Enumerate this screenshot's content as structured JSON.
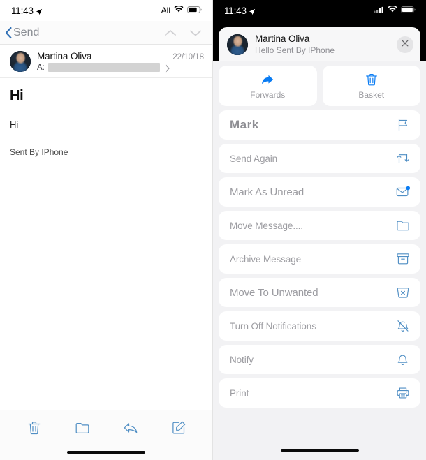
{
  "left": {
    "status": {
      "time": "11:43",
      "carrier_label": "All",
      "location_icon": "location-arrow-icon",
      "wifi_icon": "wifi-icon",
      "battery_icon": "battery-icon"
    },
    "nav": {
      "back_label": "Send",
      "back_icon": "chevron-left-icon",
      "prev_icon": "chevron-up-icon",
      "next_icon": "chevron-down-icon"
    },
    "message": {
      "sender": "Martina Oliva",
      "date": "22/10/18",
      "to_label": "A:",
      "to_value": "",
      "detail_icon": "chevron-right-icon",
      "subject": "Hi",
      "body": "Hi",
      "signature": "Sent By IPhone"
    },
    "toolbar": [
      {
        "name": "delete-button",
        "icon": "trash-icon"
      },
      {
        "name": "move-button",
        "icon": "folder-icon"
      },
      {
        "name": "reply-button",
        "icon": "reply-arrow-icon"
      },
      {
        "name": "compose-button",
        "icon": "compose-icon"
      }
    ]
  },
  "right": {
    "status": {
      "time": "11:43",
      "location_icon": "location-arrow-icon",
      "signal_icon": "cellular-signal-icon",
      "wifi_icon": "wifi-icon",
      "battery_icon": "battery-icon"
    },
    "card": {
      "sender": "Martina Oliva",
      "preview": "Hello Sent By IPhone",
      "close_icon": "close-icon"
    },
    "quick_actions": [
      {
        "label": "Forwards",
        "icon": "forward-arrow-icon"
      },
      {
        "label": "Basket",
        "icon": "trash-icon"
      }
    ],
    "menu_items": [
      {
        "label": "Mark",
        "icon": "flag-icon",
        "size": "big"
      },
      {
        "label": "Send Again",
        "icon": "resend-icon",
        "size": "sm"
      },
      {
        "label": "Mark As Unread",
        "icon": "envelope-badge-icon",
        "size": "lg"
      },
      {
        "label": "Move Message....",
        "icon": "folder-icon",
        "size": "sm"
      },
      {
        "label": "Archive Message",
        "icon": "archive-box-icon",
        "size": "sm"
      },
      {
        "label": "Move To Unwanted",
        "icon": "junk-bin-icon",
        "size": "lg"
      },
      {
        "label": "Turn Off Notifications",
        "icon": "bell-slash-icon",
        "size": "sm"
      },
      {
        "label": "Notify",
        "icon": "bell-icon",
        "size": "sm"
      },
      {
        "label": "Print",
        "icon": "printer-icon",
        "size": "sm"
      }
    ]
  },
  "colors": {
    "accent": "#0a7cf3",
    "icon_blue": "#4f8ec4",
    "muted_text": "#9c9ca1",
    "sheet_bg": "#f2f2f4"
  }
}
